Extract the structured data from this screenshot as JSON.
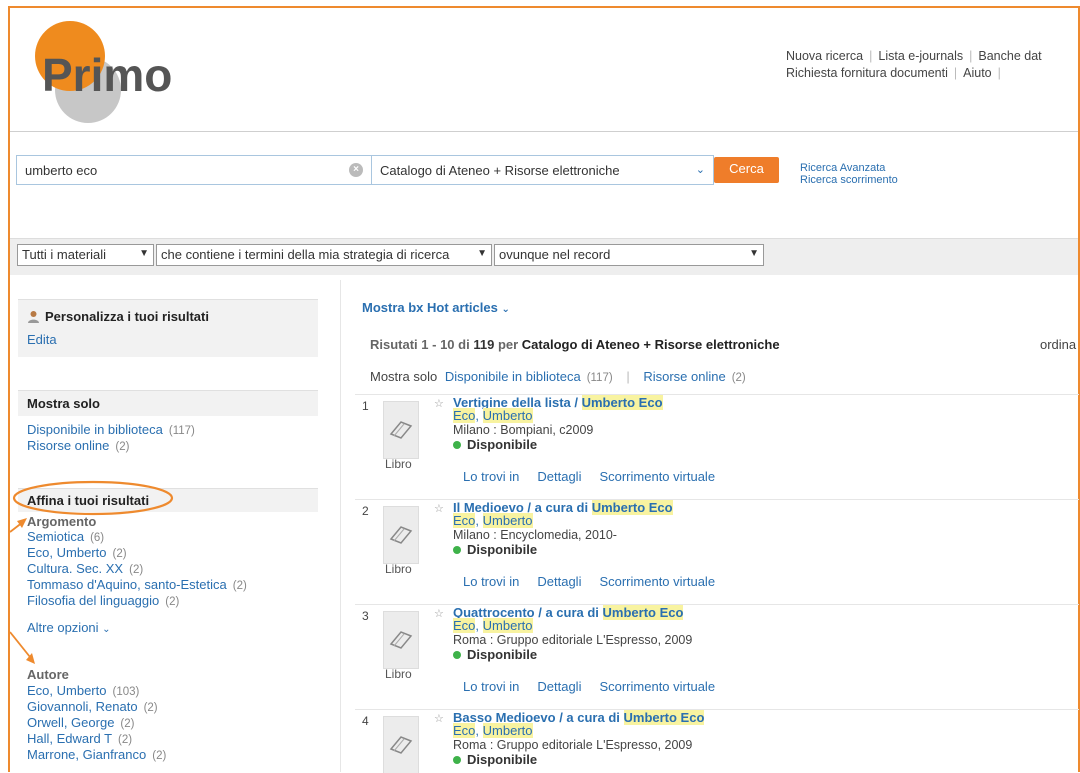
{
  "logo": {
    "text": "Primo",
    "colors": {
      "orange": "#ef8b1e",
      "gray": "#c7c7c7",
      "text": "#555555"
    }
  },
  "topnav": {
    "items_row1": [
      "Nuova ricerca",
      "Lista e-journals",
      "Banche dat"
    ],
    "items_row2": [
      "Richiesta fornitura documenti",
      "Aiuto"
    ]
  },
  "search": {
    "query": "umberto eco",
    "scope": "Catalogo di Ateneo + Risorse elettroniche",
    "submit_label": "Cerca",
    "advanced": "Ricerca Avanzata",
    "browse": "Ricerca scorrimento"
  },
  "filters": {
    "materials": "Tutti i materiali",
    "contains": "che contiene i termini della mia strategia di ricerca",
    "where": "ovunque nel record"
  },
  "sidebar": {
    "personalize_title": "Personalizza i tuoi risultati",
    "edit_label": "Edita",
    "show_only_title": "Mostra solo",
    "show_only": [
      {
        "label": "Disponibile in biblioteca",
        "count": "(117)"
      },
      {
        "label": "Risorse online",
        "count": "(2)"
      }
    ],
    "refine_title": "Affina i tuoi risultati",
    "argomento_title": "Argomento",
    "argomento": [
      {
        "label": "Semiotica",
        "count": "(6)"
      },
      {
        "label": "Eco, Umberto",
        "count": "(2)"
      },
      {
        "label": "Cultura. Sec. XX",
        "count": "(2)"
      },
      {
        "label": "Tommaso d'Aquino, santo-Estetica",
        "count": "(2)"
      },
      {
        "label": "Filosofia del linguaggio",
        "count": "(2)"
      }
    ],
    "more_options": "Altre opzioni",
    "autore_title": "Autore",
    "autore": [
      {
        "label": "Eco, Umberto",
        "count": "(103)"
      },
      {
        "label": "Giovannoli, Renato",
        "count": "(2)"
      },
      {
        "label": "Orwell, George",
        "count": "(2)"
      },
      {
        "label": "Hall, Edward T",
        "count": "(2)"
      },
      {
        "label": "Marrone, Gianfranco",
        "count": "(2)"
      }
    ]
  },
  "results": {
    "hot_articles": "Mostra bx Hot articles",
    "summary_prefix": "Risutati 1 - 10 di",
    "total": "119",
    "summary_per": "per",
    "summary_scope": "Catalogo di Ateneo + Risorse elettroniche",
    "sort_label": "ordina",
    "show_only_label": "Mostra solo",
    "avail_lib": "Disponibile in biblioteca",
    "avail_lib_count": "(117)",
    "online": "Risorse online",
    "online_count": "(2)",
    "item_type": "Libro",
    "action_find": "Lo trovi in",
    "action_details": "Dettagli",
    "action_browse": "Scorrimento virtuale",
    "items": [
      {
        "num": "1",
        "title_pre": "Vertigine della lista / ",
        "title_hl": "Umberto Eco",
        "author_a": "Eco",
        "author_b": "Umberto",
        "pub": "Milano : Bompiani, c2009",
        "status": "Disponibile"
      },
      {
        "num": "2",
        "title_pre": "Il Medioevo / a cura di ",
        "title_hl": "Umberto Eco",
        "author_a": "Eco",
        "author_b": "Umberto",
        "pub": "Milano : Encyclomedia, 2010-",
        "status": "Disponibile"
      },
      {
        "num": "3",
        "title_pre": "Quattrocento / a cura di ",
        "title_hl": "Umberto Eco",
        "author_a": "Eco",
        "author_b": "Umberto",
        "pub": "Roma : Gruppo editoriale L'Espresso, 2009",
        "status": "Disponibile"
      },
      {
        "num": "4",
        "title_pre": "Basso Medioevo / a cura di ",
        "title_hl": "Umberto Eco",
        "author_a": "Eco",
        "author_b": "Umberto",
        "pub": "Roma : Gruppo editoriale L'Espresso, 2009",
        "status": "Disponibile"
      }
    ]
  },
  "accent_color": "#ee8a2e",
  "link_color": "#2a6fb0"
}
